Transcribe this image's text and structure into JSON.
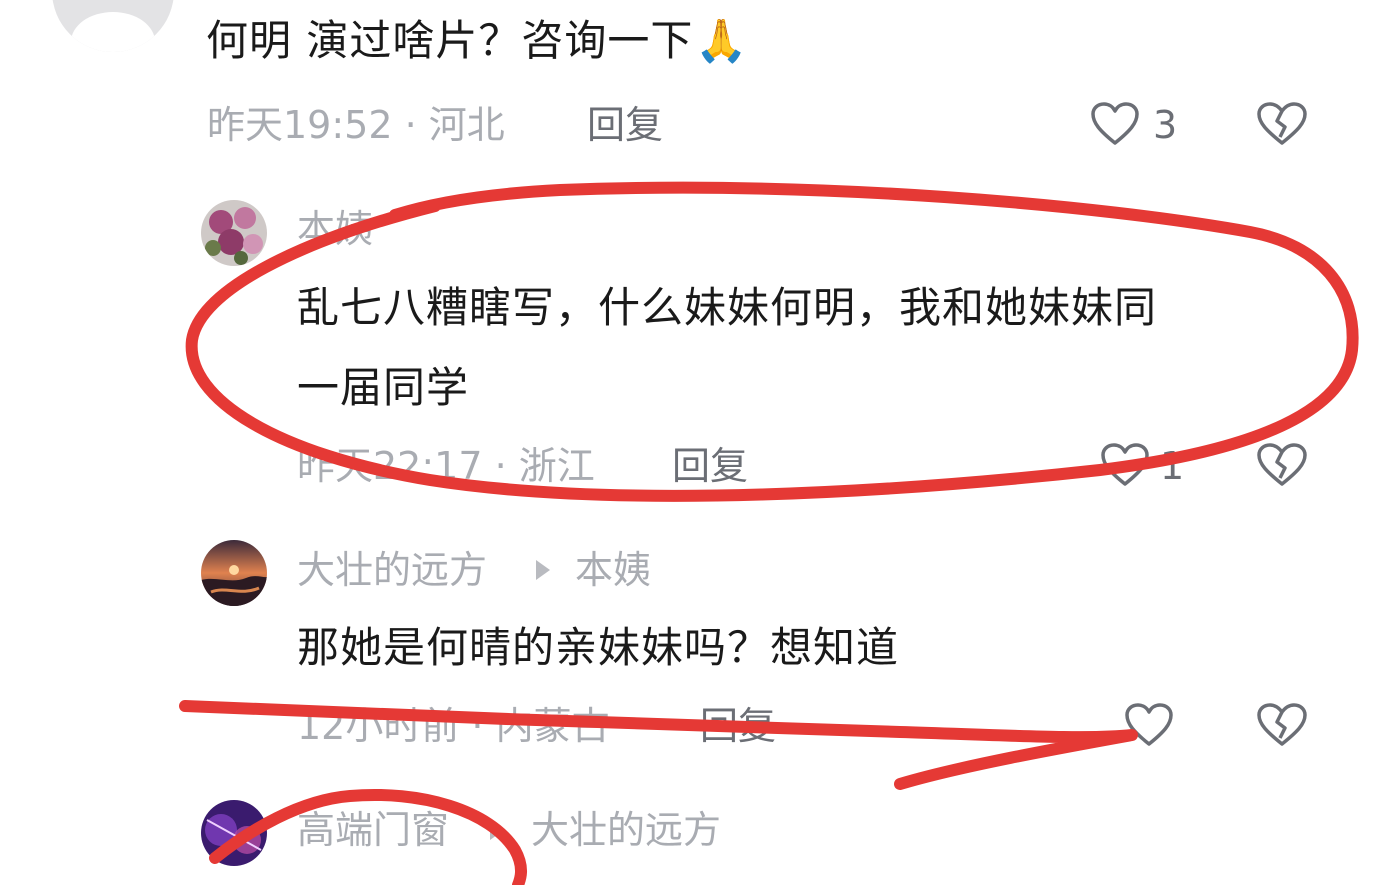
{
  "comments": [
    {
      "text": "何明 演过啥片？咨询一下",
      "emoji": "🙏",
      "meta": "昨天19:52 · 河北",
      "reply_label": "回复",
      "likes": "3"
    },
    {
      "username": "本姨",
      "text_line1": "乱七八糟瞎写，什么妹妹何明，我和她妹妹同",
      "text_line2": "一届同学",
      "meta": "昨天22:17 · 浙江",
      "reply_label": "回复",
      "likes": "1"
    },
    {
      "username": "大壮的远方",
      "reply_to": "本姨",
      "text": "那她是何晴的亲妹妹吗？想知道",
      "meta": "12小时前 · 内蒙古",
      "reply_label": "回复",
      "likes": ""
    },
    {
      "username": "高端门窗",
      "reply_to": "大壮的远方"
    }
  ],
  "icons": {
    "like": "heart-outline-icon",
    "dislike": "broken-heart-icon",
    "reply_arrow": "play-arrow-icon"
  },
  "colors": {
    "annotation": "#e53935",
    "meta_text": "#a9acb2"
  }
}
